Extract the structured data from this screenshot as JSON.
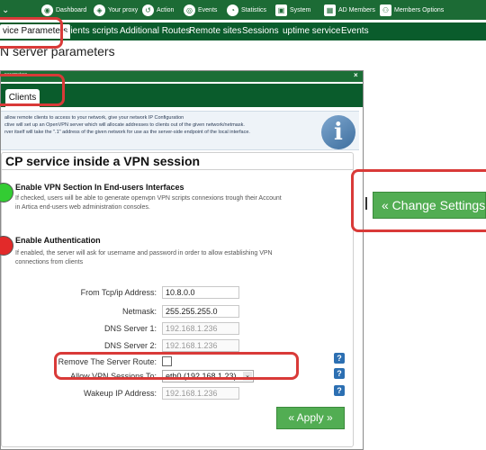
{
  "nav": [
    {
      "label": "Dashboard",
      "icon": "dashboard-icon"
    },
    {
      "label": "Your proxy",
      "icon": "proxy-icon"
    },
    {
      "label": "Action",
      "icon": "action-icon"
    },
    {
      "label": "Events",
      "icon": "eye-icon"
    },
    {
      "label": "Statistics",
      "icon": "statistics-icon"
    },
    {
      "label": "System",
      "icon": "system-icon"
    },
    {
      "label": "AD Members",
      "icon": "grid-icon"
    },
    {
      "label": "Members Options",
      "icon": "members-icon"
    }
  ],
  "tabs": [
    "vice Parameters",
    "Clients scripts",
    "Additional Routes",
    "Remote sites",
    "Sessions",
    "uptime service",
    "Events"
  ],
  "page_title": "N server parameters",
  "dialog": {
    "title": "parameters",
    "close": "×",
    "tab": "Clients",
    "info": [
      "allow remote clients to access to your network, give your network IP Configuration",
      "ctive will set up an OpenVPN server which will allocate addresses to clients out of the given network/netmask.",
      "rver itself will take the \".1\" address of the given network for use as the server-side endpoint of the local interface."
    ],
    "info_icon": "i",
    "panel_title": "CP service inside a VPN session",
    "features": [
      {
        "title": "Enable VPN Section In End-users Interfaces",
        "desc": [
          "If checked, users will be able to generate openvpn VPN scripts connexions trough their Account",
          "in Artica end-users web administration consoles."
        ],
        "color": "#33cc33"
      },
      {
        "title": "Enable Authentication",
        "desc": [
          "If enabled, the server will ask for username and password in order to allow establishing VPN",
          "connections from clients"
        ],
        "color": "#e22a2a"
      }
    ],
    "fields": {
      "from_label": "From Tcp/ip Address:",
      "from_value": "10.8.0.0",
      "netmask_label": "Netmask:",
      "netmask_value": "255.255.255.0",
      "dns1_label": "DNS Server 1:",
      "dns1_value": "192.168.1.236",
      "dns2_label": "DNS Server 2:",
      "dns2_value": "192.168.1.236",
      "remove_route_label": "Remove The Server Route:",
      "allow_label": "Allow VPN Sessions To:",
      "allow_value": "eth0 (192.168.1.23)",
      "wakeup_label": "Wakeup IP Address:",
      "wakeup_value": "192.168.1.236"
    },
    "apply": "« Apply »"
  },
  "change_settings": "« Change Settings »",
  "highlight_color": "#d93a38"
}
